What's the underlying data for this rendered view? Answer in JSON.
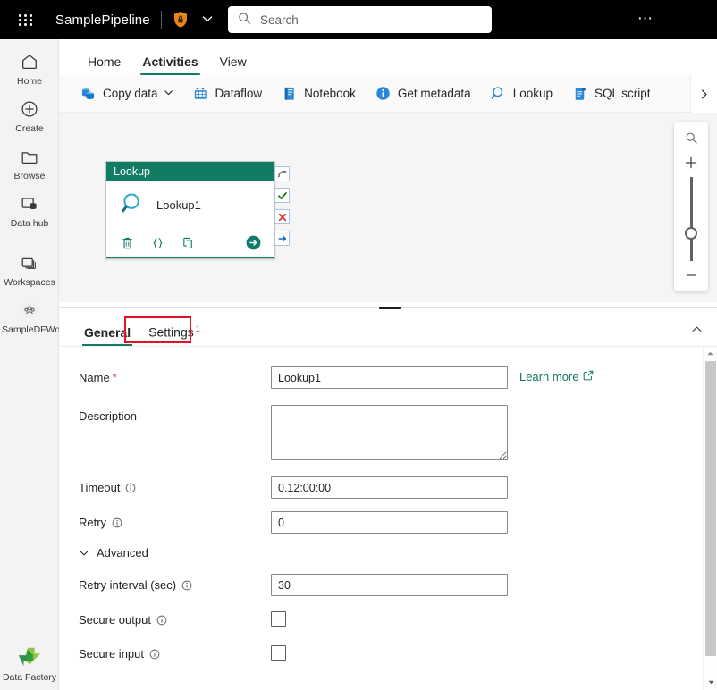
{
  "topbar": {
    "waffle_label": "App launcher",
    "title": "SamplePipeline",
    "search_placeholder": "Search",
    "search_value": "",
    "more_label": "…"
  },
  "rail": {
    "items": [
      {
        "label": "Home",
        "icon": "home-icon"
      },
      {
        "label": "Create",
        "icon": "plus-circle-icon"
      },
      {
        "label": "Browse",
        "icon": "folder-icon"
      },
      {
        "label": "Data hub",
        "icon": "data-hub-icon"
      },
      {
        "label": "Workspaces",
        "icon": "workspaces-icon"
      },
      {
        "label": "SampleDFWorkspace",
        "icon": "workspace-people-icon"
      }
    ],
    "footer": {
      "label": "Data Factory",
      "icon": "data-factory-logo"
    }
  },
  "ribbon": {
    "tabs": [
      {
        "label": "Home",
        "active": false
      },
      {
        "label": "Activities",
        "active": true
      },
      {
        "label": "View",
        "active": false
      }
    ],
    "toolbar": [
      {
        "label": "Copy data",
        "icon": "copy-data-icon",
        "caret": true
      },
      {
        "label": "Dataflow",
        "icon": "dataflow-icon",
        "caret": false
      },
      {
        "label": "Notebook",
        "icon": "notebook-icon",
        "caret": false
      },
      {
        "label": "Get metadata",
        "icon": "info-circle-icon",
        "caret": false
      },
      {
        "label": "Lookup",
        "icon": "lookup-magnifier-icon",
        "caret": false
      },
      {
        "label": "SQL script",
        "icon": "sql-script-icon",
        "caret": false
      }
    ],
    "overflow_label": "More commands"
  },
  "canvas": {
    "node": {
      "header": "Lookup",
      "name": "Lookup1",
      "icon": "lookup-magnifier-icon",
      "actions": [
        {
          "name": "delete-activity-button",
          "icon": "trash-icon"
        },
        {
          "name": "code-view-button",
          "icon": "braces-icon"
        },
        {
          "name": "clone-activity-button",
          "icon": "copy-icon"
        }
      ],
      "run_label": "Run activity",
      "connectors": [
        {
          "name": "on-skip-connector",
          "icon": "skip-arrow-icon",
          "color": "#5c5c5c"
        },
        {
          "name": "on-success-connector",
          "icon": "check-icon",
          "color": "#107c10"
        },
        {
          "name": "on-failure-connector",
          "icon": "cross-icon",
          "color": "#d13438"
        },
        {
          "name": "on-completion-connector",
          "icon": "arrow-right-icon",
          "color": "#0f6cbd"
        }
      ]
    },
    "zoom_controls": {
      "fit_label": "Zoom to fit",
      "in_label": "Zoom in",
      "out_label": "Zoom out",
      "slider_value": 60
    }
  },
  "properties": {
    "tabs": [
      {
        "label": "General",
        "active": true,
        "badge": "",
        "highlighted": true
      },
      {
        "label": "Settings",
        "active": false,
        "badge": "1",
        "highlighted": false
      }
    ],
    "collapse_label": "Collapse pane",
    "fields": {
      "name": {
        "label": "Name",
        "required": "*",
        "value": "Lookup1",
        "placeholder": ""
      },
      "learn_more": {
        "label": "Learn more",
        "icon": "external-link-icon"
      },
      "description": {
        "label": "Description",
        "value": "",
        "placeholder": ""
      },
      "timeout": {
        "label": "Timeout",
        "value": "0.12:00:00",
        "info": "info-icon"
      },
      "retry": {
        "label": "Retry",
        "value": "0",
        "info": "info-icon"
      },
      "advanced": {
        "label": "Advanced",
        "expanded": true
      },
      "retry_interval": {
        "label": "Retry interval (sec)",
        "value": "30",
        "info": "info-icon"
      },
      "secure_output": {
        "label": "Secure output",
        "checked": false,
        "info": "info-icon"
      },
      "secure_input": {
        "label": "Secure input",
        "checked": false,
        "info": "info-icon"
      }
    }
  },
  "colors": {
    "accent_teal": "#107c63",
    "annotation_red": "#e81123",
    "required_red": "#d13438",
    "link_teal": "#117865"
  }
}
